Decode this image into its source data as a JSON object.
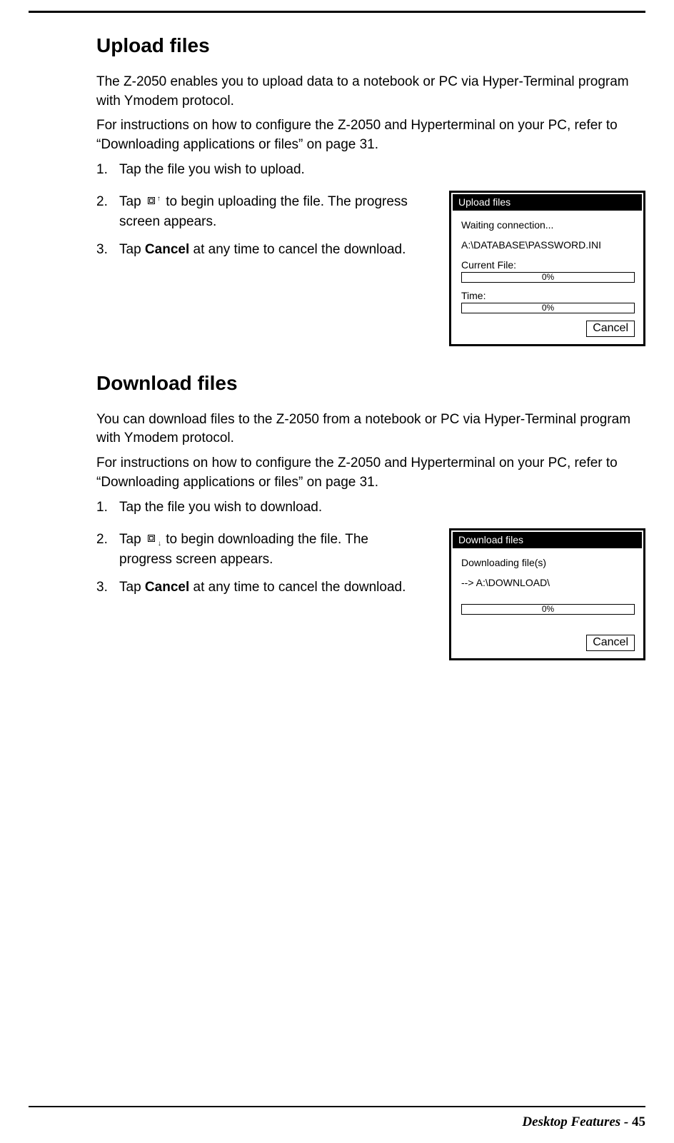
{
  "sections": {
    "upload": {
      "heading": "Upload files",
      "intro1": "The Z-2050 enables you to upload data to a notebook or PC via Hyper-Terminal program with Ymodem protocol.",
      "intro2": "For instructions on how to configure the Z-2050 and Hyperterminal on your PC, refer to “Downloading applications or files” on page 31.",
      "steps": {
        "s1": {
          "num": "1.",
          "text": "Tap the file you wish to upload."
        },
        "s2": {
          "num": "2.",
          "pre": "Tap ",
          "post": " to begin uploading the file. The progress screen appears."
        },
        "s3": {
          "num": "3.",
          "pre": "Tap ",
          "bold": "Cancel",
          "post": " at any time to cancel the download."
        }
      },
      "shot": {
        "title": "Upload files",
        "status": "Waiting connection...",
        "path": "A:\\DATABASE\\PASSWORD.INI",
        "label1": "Current File:",
        "pct1": "0%",
        "label2": "Time:",
        "pct2": "0%",
        "cancel": "Cancel"
      }
    },
    "download": {
      "heading": "Download files",
      "intro1": "You can download files to the Z-2050 from a notebook or PC via Hyper-Terminal program with Ymodem protocol.",
      "intro2": "For instructions on how to configure the Z-2050 and Hyperterminal on your PC, refer to “Downloading applications or files” on page 31.",
      "steps": {
        "s1": {
          "num": "1.",
          "text": "Tap the file you wish to download."
        },
        "s2": {
          "num": "2.",
          "pre": "Tap ",
          "post": " to begin downloading the file. The progress screen appears."
        },
        "s3": {
          "num": "3.",
          "pre": "Tap ",
          "bold": "Cancel",
          "post": " at any time to cancel the download."
        }
      },
      "shot": {
        "title": "Download files",
        "status": "Downloading file(s)",
        "path": "--> A:\\DOWNLOAD\\",
        "pct1": "0%",
        "cancel": "Cancel"
      }
    }
  },
  "footer": {
    "label": "Desktop Features - ",
    "page": "45"
  }
}
